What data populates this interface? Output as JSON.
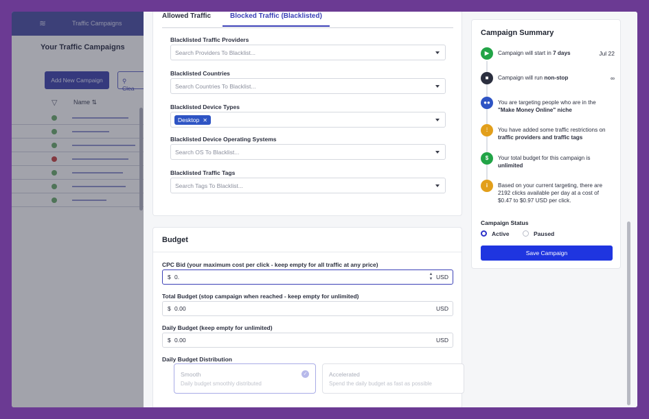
{
  "background_app": {
    "topbar_title": "Traffic Campaigns",
    "page_title": "Your Traffic Campaigns",
    "add_button": "Add New Campaign",
    "clear_button": "Clea",
    "name_header": "Name",
    "row_status_colors": [
      "#6aa66c",
      "#6aa66c",
      "#6aa66c",
      "#c04444",
      "#6aa66c",
      "#6aa66c",
      "#6aa66c"
    ]
  },
  "tabs": [
    {
      "label": "Allowed Traffic"
    },
    {
      "label": "Blocked Traffic (Blacklisted)"
    }
  ],
  "blacklist": {
    "providers": {
      "label": "Blacklisted Traffic Providers",
      "placeholder": "Search Providers To Blacklist..."
    },
    "countries": {
      "label": "Blacklisted Countries",
      "placeholder": "Search Countries To Blacklist..."
    },
    "device_types": {
      "label": "Blacklisted Device Types",
      "chip": "Desktop"
    },
    "os": {
      "label": "Blacklisted Device Operating Systems",
      "placeholder": "Search OS To Blacklist..."
    },
    "tags": {
      "label": "Blacklisted Traffic Tags",
      "placeholder": "Search Tags To Blacklist..."
    }
  },
  "budget": {
    "heading": "Budget",
    "cpc": {
      "label": "CPC Bid (your maximum cost per click - keep empty for all traffic at any price)",
      "currency": "$",
      "value": "0.",
      "unit": "USD"
    },
    "total": {
      "label": "Total Budget (stop campaign when reached - keep empty for unlimited)",
      "currency": "$",
      "value": "0.00",
      "unit": "USD"
    },
    "daily": {
      "label": "Daily Budget (keep empty for unlimited)",
      "currency": "$",
      "value": "0.00",
      "unit": "USD"
    },
    "distribution_label": "Daily Budget Distribution",
    "smooth": {
      "title": "Smooth",
      "desc": "Daily budget smoothly distributed"
    },
    "accelerated": {
      "title": "Accelerated",
      "desc": "Spend the daily budget as fast as possible"
    }
  },
  "summary": {
    "title": "Campaign Summary",
    "start": {
      "pre": "Campaign will start in ",
      "bold": "7 days",
      "date": "Jul 22"
    },
    "run": {
      "pre": "Campaign will run ",
      "bold": "non-stop",
      "symbol": "∞"
    },
    "targeting": {
      "line1": "You are targeting people who are in the",
      "line2": "\"Make Money Online\" niche"
    },
    "restrictions": {
      "line1": "You have added some traffic restrictions on",
      "line2": "traffic providers and traffic tags"
    },
    "budget": {
      "line1": "Your total budget for this campaign is",
      "line2": "unlimited"
    },
    "estimate": {
      "line1": "Based on your current targeting, there are",
      "line2": "2192 clicks available per day at a cost of",
      "line3": "$0.47 to $0.97 USD per click."
    },
    "status_label": "Campaign Status",
    "status_active": "Active",
    "status_paused": "Paused",
    "save_button": "Save Campaign"
  },
  "colors": {
    "accent": "#3a3fb6",
    "save": "#1f35e0",
    "green": "#22a447",
    "dark": "#2b2f3f",
    "blue": "#2e54c4",
    "orange": "#e29f1b"
  }
}
